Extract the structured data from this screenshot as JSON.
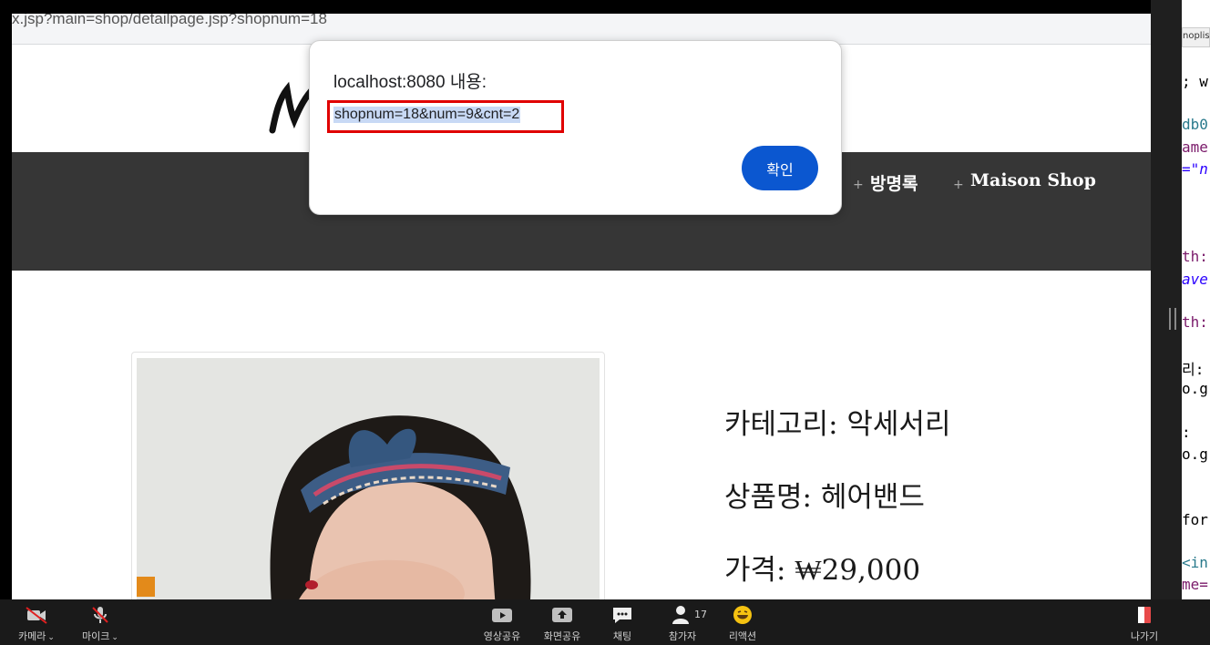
{
  "browser": {
    "url": "x.jsp?main=shop/detailpage.jsp?shopnum=18"
  },
  "site": {
    "nav": [
      "방명록",
      "Maison Shop"
    ]
  },
  "product": {
    "category": "카테고리: 악세서리",
    "name": "상품명: 헤어밴드",
    "price": "가격: ₩29,000"
  },
  "dialog": {
    "title": "localhost:8080 내용:",
    "message": "shopnum=18&num=9&cnt=2",
    "ok_label": "확인"
  },
  "ide": {
    "tab": "noplis",
    "lines": [
      ";  w",
      "db0",
      "ame",
      "=\"n",
      "th:",
      "ave",
      "th:",
      "리:",
      "o.g",
      ":",
      "o.g",
      "for",
      "<in",
      "me="
    ]
  },
  "zoom": {
    "camera": "카메라",
    "mic": "마이크",
    "video_share": "영상공유",
    "screen_share": "화면공유",
    "chat": "채팅",
    "participants": "참가자",
    "participant_count": "17",
    "reactions": "리액션",
    "leave": "나가기"
  }
}
